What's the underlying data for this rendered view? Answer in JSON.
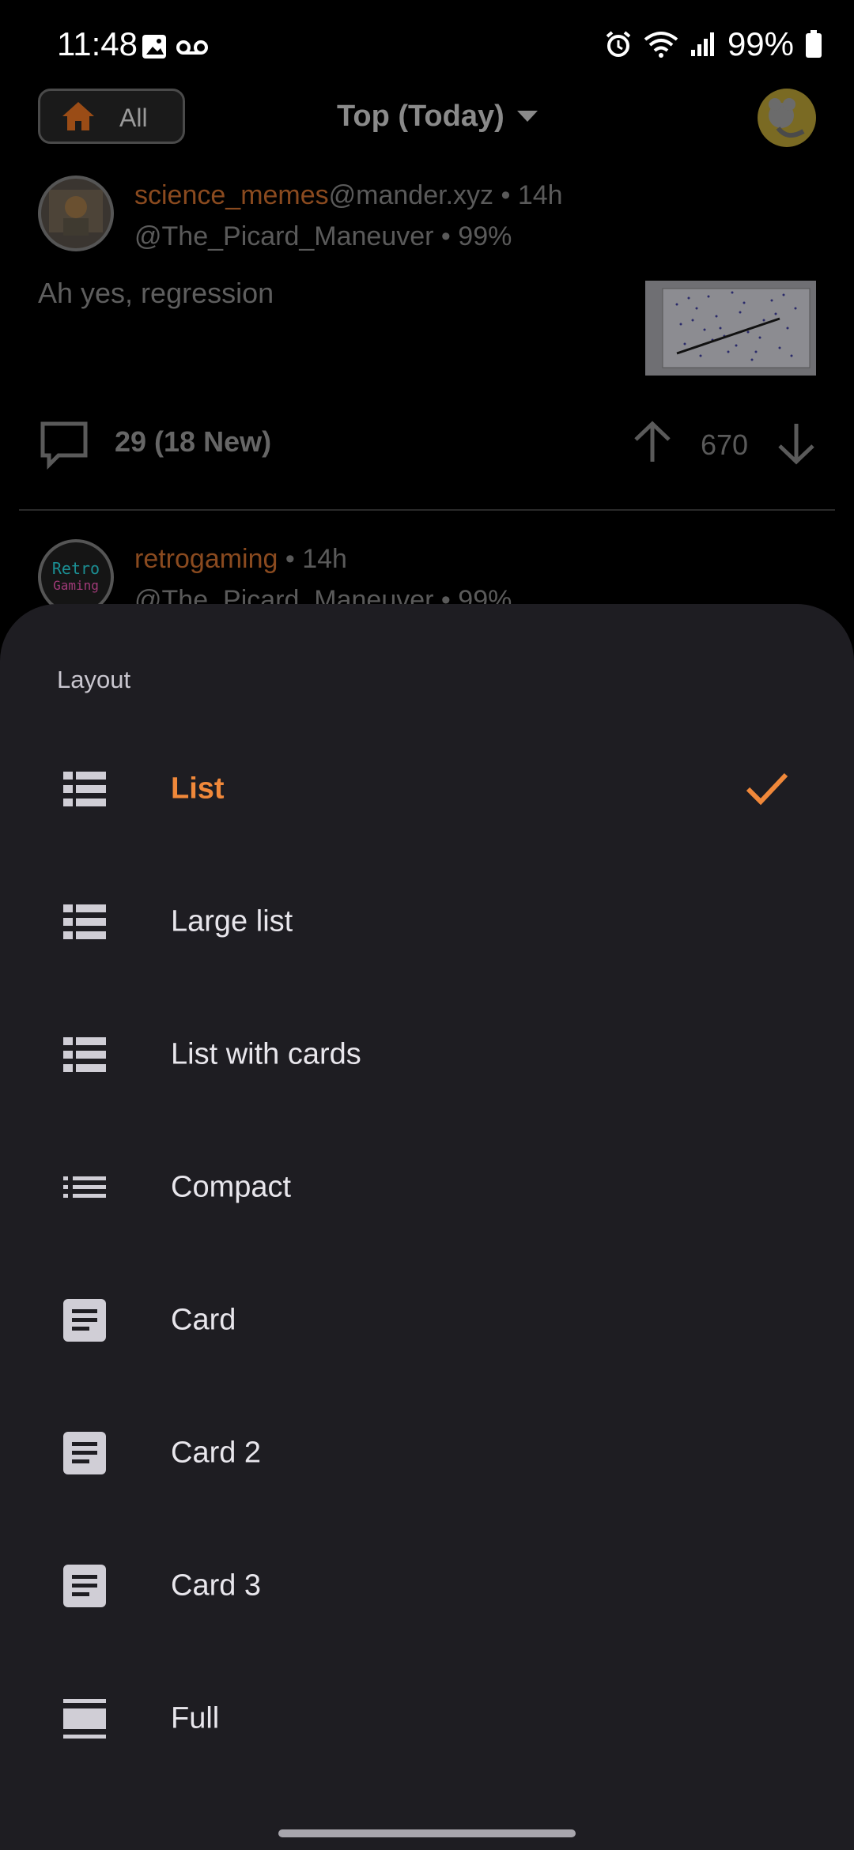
{
  "status_bar": {
    "time": "11:48",
    "battery": "99%"
  },
  "top_bar": {
    "feed_button_label": "All",
    "sort_label": "Top (Today)"
  },
  "posts": [
    {
      "community": "science_memes",
      "instance": "@mander.xyz",
      "age": " • 14h",
      "author": "@The_Picard_Maneuver",
      "score_pct": " • 99%",
      "title": "Ah yes, regression",
      "comments": "29 (18 New)",
      "votes": "670"
    },
    {
      "community": "retrogaming",
      "age": " • 14h",
      "author": "@The_Picard_Maneuver",
      "score_pct": " • 99%",
      "avatar_text_top": "Retro",
      "avatar_text_bottom": "Gaming"
    }
  ],
  "sheet": {
    "title": "Layout",
    "options": [
      {
        "label": "List",
        "icon": "list-icon",
        "selected": true
      },
      {
        "label": "Large list",
        "icon": "list-icon"
      },
      {
        "label": "List with cards",
        "icon": "list-icon"
      },
      {
        "label": "Compact",
        "icon": "compact-list-icon"
      },
      {
        "label": "Card",
        "icon": "card-icon"
      },
      {
        "label": "Card 2",
        "icon": "card-icon"
      },
      {
        "label": "Card 3",
        "icon": "card-icon"
      },
      {
        "label": "Full",
        "icon": "full-icon"
      }
    ]
  },
  "colors": {
    "accent": "#f0883a",
    "sheet_bg": "#1e1d22",
    "option_text": "#e8e6ec"
  }
}
